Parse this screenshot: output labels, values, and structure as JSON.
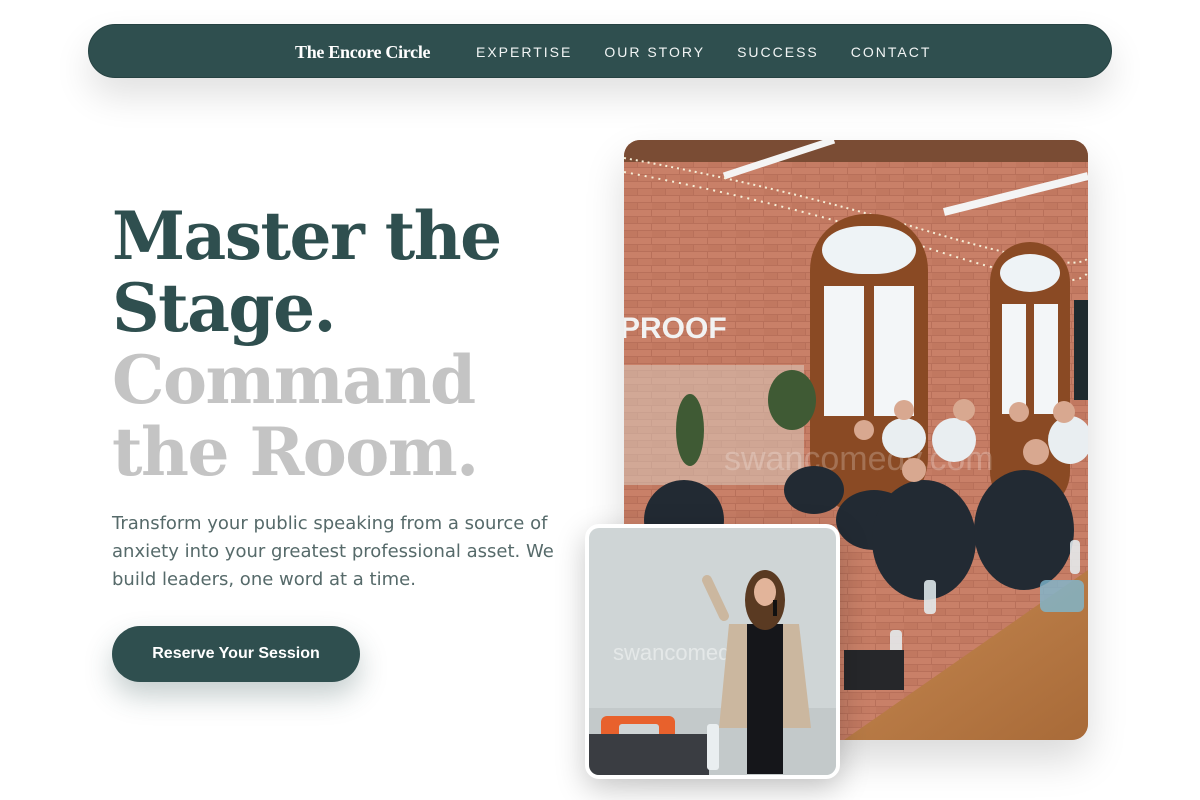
{
  "nav": {
    "brand": "The Encore Circle",
    "links": [
      "EXPERTISE",
      "OUR STORY",
      "SUCCESS",
      "CONTACT"
    ]
  },
  "hero": {
    "line1": "Master the",
    "line2": "Stage.",
    "line3": "Command",
    "line4": "the Room.",
    "subtext": "Transform your public speaking from a source of anxiety into your greatest professional asset. We build leaders, one word at a time.",
    "cta_label": "Reserve Your Session"
  },
  "images": {
    "main_sign": "PROOF",
    "watermark": "swancomedy.com"
  },
  "colors": {
    "primary": "#2f4f4f",
    "headline_light": "#c4c4c4",
    "body_text": "#566a6a"
  }
}
